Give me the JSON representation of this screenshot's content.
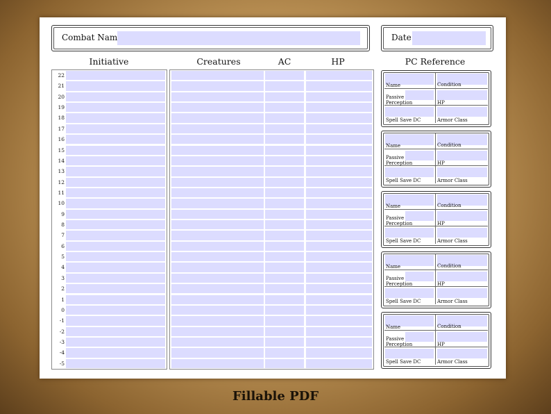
{
  "header": {
    "combat_name_label": "Combat Name",
    "date_label": "Date"
  },
  "columns": {
    "initiative": "Initiative",
    "creatures": "Creatures",
    "ac": "AC",
    "hp": "HP",
    "pc_reference": "PC Reference"
  },
  "initiative_numbers": [
    "22",
    "21",
    "20",
    "19",
    "18",
    "17",
    "16",
    "15",
    "14",
    "13",
    "12",
    "11",
    "10",
    "9",
    "8",
    "7",
    "6",
    "5",
    "4",
    "3",
    "2",
    "1",
    "0",
    "-1",
    "-2",
    "-3",
    "-4",
    "-5"
  ],
  "pc_card": {
    "name": "Name",
    "condition": "Condition",
    "passive_perception": "Passive Perception",
    "hp": "HP",
    "spell_save_dc": "Spell Save DC",
    "armor_class": "Armor Class"
  },
  "caption": "Fillable PDF",
  "colors": {
    "field_fill": "#dcdcff",
    "paper": "#ffffff",
    "parchment": "#c49a5c"
  }
}
